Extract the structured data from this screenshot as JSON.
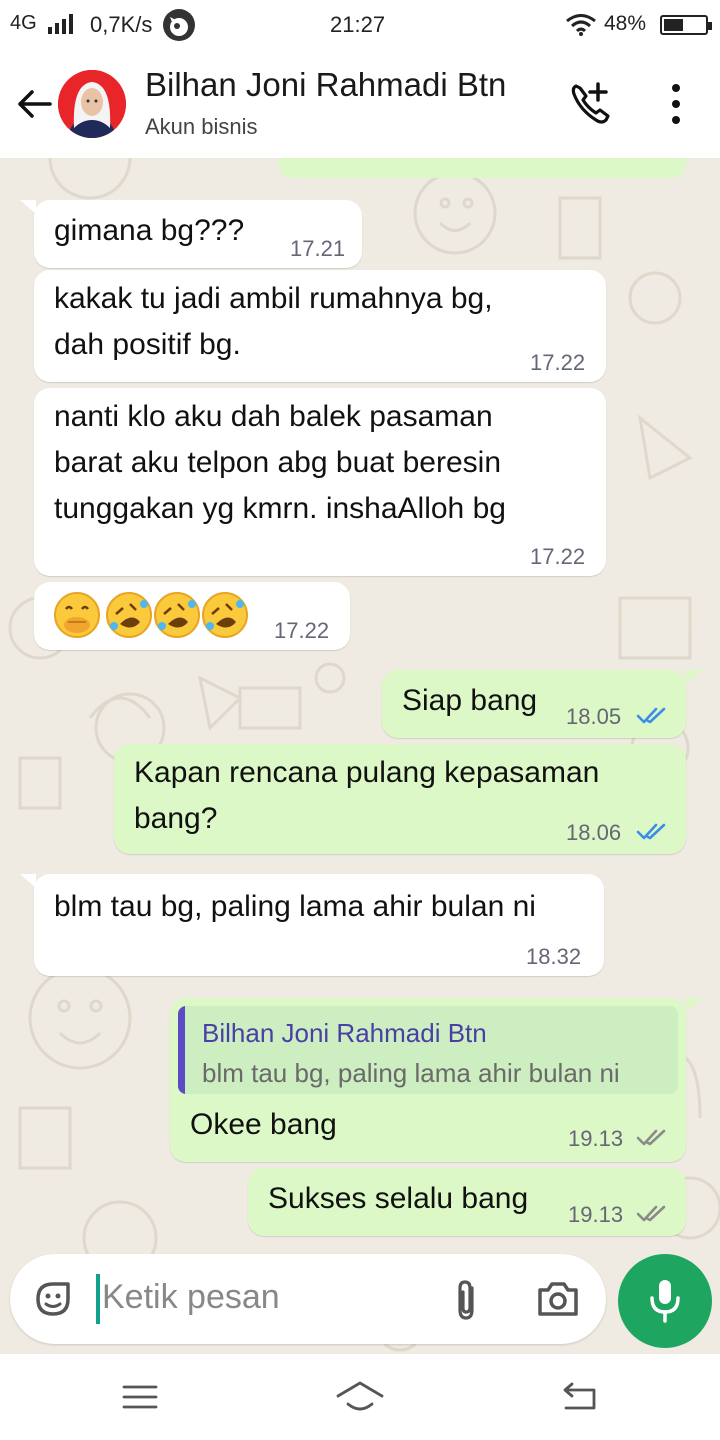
{
  "status_bar": {
    "network": "4G",
    "speed": "0,7K/s",
    "time": "21:27",
    "battery": "48%",
    "battery_level": 0.48
  },
  "header": {
    "contact_name": "Bilhan Joni Rahmadi Btn",
    "subtitle": "Akun bisnis"
  },
  "messages": [
    {
      "direction": "in",
      "lines": [
        "gimana bg???"
      ],
      "time": "17.21"
    },
    {
      "direction": "in",
      "lines": [
        "kakak tu jadi ambil rumahnya bg,",
        "dah positif bg."
      ],
      "time": "17.22"
    },
    {
      "direction": "in",
      "lines": [
        "nanti klo aku dah balek pasaman",
        "barat aku telpon abg buat beresin",
        "tunggakan yg kmrn. inshaAlloh bg"
      ],
      "time": "17.22"
    },
    {
      "direction": "in",
      "emoji": [
        "face-with-hand-over-mouth",
        "rolling-on-floor-laughing",
        "rolling-on-floor-laughing",
        "rolling-on-floor-laughing"
      ],
      "time": "17.22"
    },
    {
      "direction": "out",
      "lines": [
        "Siap bang"
      ],
      "time": "18.05",
      "status": "read"
    },
    {
      "direction": "out",
      "lines": [
        "Kapan rencana pulang kepasaman",
        "bang?"
      ],
      "time": "18.06",
      "status": "read"
    },
    {
      "direction": "in",
      "lines": [
        "blm tau bg, paling lama ahir bulan ni"
      ],
      "time": "18.32"
    },
    {
      "direction": "out",
      "quote": {
        "name": "Bilhan Joni Rahmadi Btn",
        "text": "blm tau bg, paling lama ahir bulan ni"
      },
      "lines": [
        "Okee bang"
      ],
      "time": "19.13",
      "status": "delivered"
    },
    {
      "direction": "out",
      "lines": [
        "Sukses selalu bang"
      ],
      "time": "19.13",
      "status": "delivered"
    }
  ],
  "input": {
    "placeholder": "Ketik pesan"
  },
  "icons": {
    "back": "arrow-left",
    "call": "add-call",
    "menu": "more-vertical",
    "sticker": "sticker",
    "attach": "paperclip",
    "camera": "camera",
    "mic": "microphone",
    "nav": [
      "menu",
      "home",
      "back"
    ]
  },
  "colors": {
    "outgoing_bubble": "#dcf8c6",
    "incoming_bubble": "#ffffff",
    "chat_background": "#efeae2",
    "read_ticks": "#3a8ee6",
    "mic_button": "#1ea660",
    "quote_bar": "#5c4bc2"
  }
}
